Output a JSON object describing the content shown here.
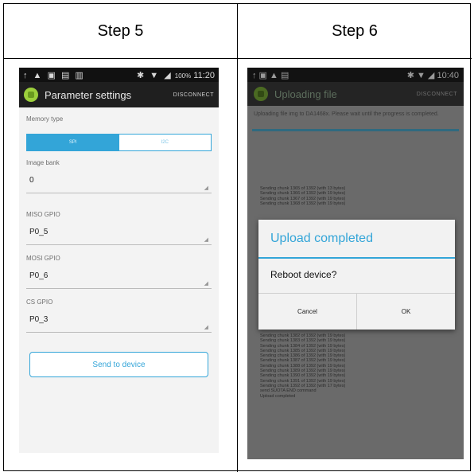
{
  "headers": {
    "left": "Step 5",
    "right": "Step 6"
  },
  "step5": {
    "status_bar": {
      "left_icons": "↑ ▲ ▣ ▤ ▥",
      "right_icons": "✱ ▼ ◢",
      "battery": "100%",
      "time": "11:20"
    },
    "action_bar": {
      "title": "Parameter settings",
      "disconnect": "DISCONNECT"
    },
    "memory_type": {
      "label": "Memory type",
      "options": [
        "SPI",
        "I2C"
      ],
      "selected": "SPI"
    },
    "image_bank": {
      "label": "Image bank",
      "value": "0"
    },
    "miso": {
      "label": "MISO GPIO",
      "value": "P0_5"
    },
    "mosi": {
      "label": "MOSI GPIO",
      "value": "P0_6"
    },
    "cs": {
      "label": "CS GPIO",
      "value": "P0_3"
    },
    "send_button": "Send to device"
  },
  "step6": {
    "status_bar": {
      "left_icons": "↑ ▣ ▲ ▤",
      "right_icons": "✱ ▼ ◢",
      "time": "10:40"
    },
    "action_bar": {
      "title": "Uploading file",
      "disconnect": "DISCONNECT"
    },
    "message": "Uploading file img to DA1468x. Please wait until the progress is completed.",
    "log_top": [
      "Sending chunk 1365 of 1392 (with 13 bytes)",
      "Sending chunk 1366 of 1392 (with 19 bytes)",
      "Sending chunk 1367 of 1392 (with 19 bytes)",
      "Sending chunk 1368 of 1392 (with 19 bytes)"
    ],
    "log_bottom": [
      "Sending chunk 1382 of 1392 (with 19 bytes)",
      "Sending chunk 1383 of 1392 (with 19 bytes)",
      "Sending chunk 1384 of 1392 (with 19 bytes)",
      "Sending chunk 1385 of 1392 (with 19 bytes)",
      "Sending chunk 1386 of 1392 (with 19 bytes)",
      "Sending chunk 1387 of 1392 (with 19 bytes)",
      "Sending chunk 1388 of 1392 (with 19 bytes)",
      "Sending chunk 1389 of 1392 (with 19 bytes)",
      "Sending chunk 1390 of 1392 (with 19 bytes)",
      "Sending chunk 1391 of 1392 (with 19 bytes)",
      "Sending chunk 1392 of 1392 (with 17 bytes)",
      "send SUOTA END command",
      "Upload completed"
    ],
    "dialog": {
      "title": "Upload completed",
      "message": "Reboot device?",
      "cancel": "Cancel",
      "ok": "OK"
    }
  }
}
